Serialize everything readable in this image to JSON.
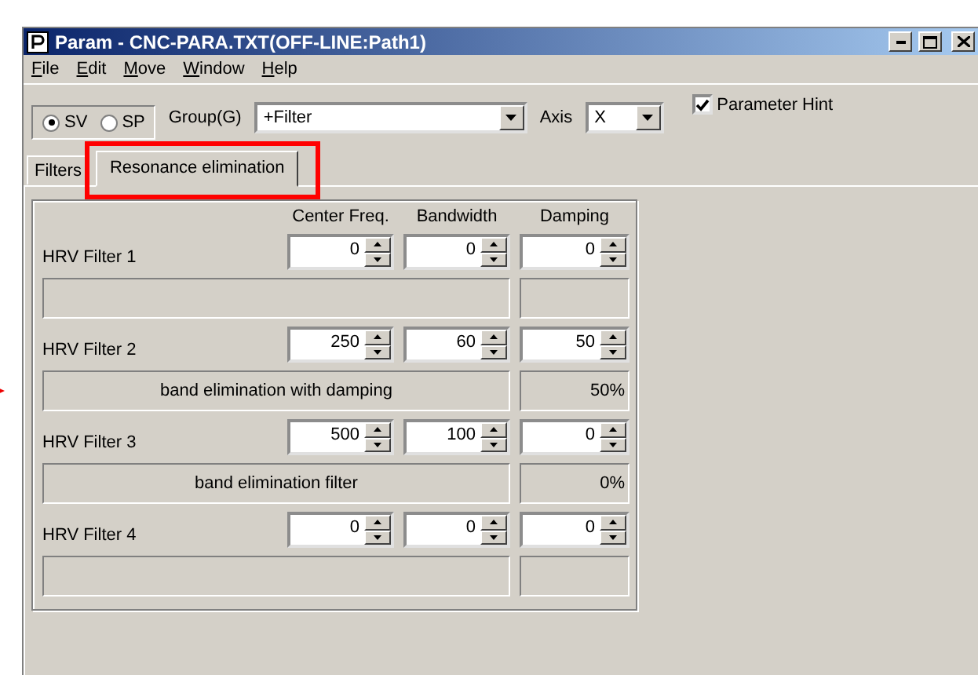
{
  "window": {
    "title": "Param - CNC-PARA.TXT(OFF-LINE:Path1)"
  },
  "menu": [
    "File",
    "Edit",
    "Move",
    "Window",
    "Help"
  ],
  "mode": [
    {
      "label": "SV",
      "selected": true
    },
    {
      "label": "SP",
      "selected": false
    }
  ],
  "group": {
    "label": "Group(G)",
    "value": "+Filter"
  },
  "axis": {
    "label": "Axis",
    "value": "X"
  },
  "parameter_hint": {
    "label": "Parameter Hint",
    "checked": true
  },
  "tabs": [
    {
      "label": "Filters",
      "selected": false,
      "annotated": false
    },
    {
      "label": "Resonance elimination",
      "selected": true,
      "annotated": true
    }
  ],
  "columns": [
    "Center Freq.",
    "Bandwidth",
    "Damping"
  ],
  "filters": [
    {
      "label": "HRV Filter 1",
      "center_freq": "0",
      "bandwidth": "0",
      "damping": "0",
      "marked": false
    },
    {
      "label": "HRV Filter 2",
      "center_freq": "250",
      "bandwidth": "60",
      "damping": "50",
      "description": "band elimination with damping",
      "damping_percent": "50%",
      "marked": true
    },
    {
      "label": "HRV Filter 3",
      "center_freq": "500",
      "bandwidth": "100",
      "damping": "0",
      "description": "band elimination filter",
      "damping_percent": "0%",
      "marked": false
    },
    {
      "label": "HRV Filter 4",
      "center_freq": "0",
      "bandwidth": "0",
      "damping": "0",
      "marked": false
    }
  ]
}
